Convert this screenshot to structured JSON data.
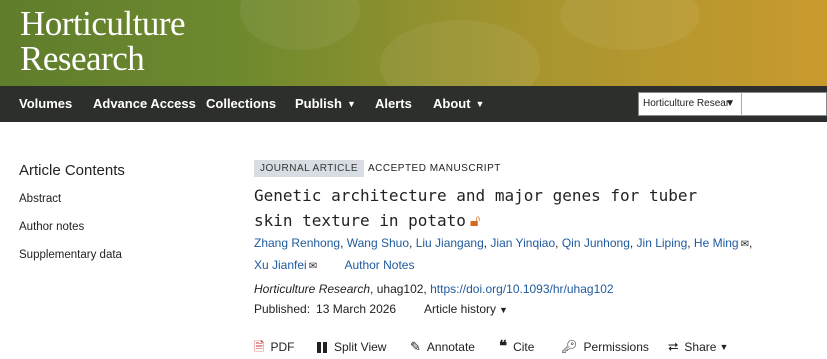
{
  "header": {
    "logo_line1": "Horticulture",
    "logo_line2": "Research"
  },
  "nav": {
    "items": [
      {
        "label": "Volumes",
        "has_dropdown": false
      },
      {
        "label": "Advance Access",
        "has_dropdown": false
      },
      {
        "label": "Collections",
        "has_dropdown": false
      },
      {
        "label": "Publish",
        "has_dropdown": true
      },
      {
        "label": "Alerts",
        "has_dropdown": false
      },
      {
        "label": "About",
        "has_dropdown": true
      }
    ],
    "search_scope": "Horticulture Resear",
    "search_value": ""
  },
  "sidebar": {
    "title": "Article Contents",
    "items": [
      "Abstract",
      "Author notes",
      "Supplementary data"
    ]
  },
  "article": {
    "type_badge": "JOURNAL ARTICLE",
    "status_badge": "ACCEPTED MANUSCRIPT",
    "title_line1": "Genetic architecture and major genes for tuber",
    "title_line2": "skin texture in potato",
    "authors": [
      "Zhang Renhong",
      "Wang Shuo",
      "Liu Jiangang",
      "Jian Yinqiao",
      "Qin Junhong",
      "Jin Liping",
      "He Ming",
      "Xu Jianfei"
    ],
    "author_notes_label": "Author Notes",
    "journal": "Horticulture Research",
    "article_id": ", uhag102, ",
    "doi": "https://doi.org/10.1093/hr/uhag102",
    "published_label": "Published:",
    "published_date": "13 March 2026",
    "history_label": "Article history"
  },
  "toolbar": {
    "pdf": "PDF",
    "split_view": "Split View",
    "annotate": "Annotate",
    "cite": "Cite",
    "permissions": "Permissions",
    "share": "Share"
  },
  "colors": {
    "nav_bg": "#2d2f2c",
    "link": "#1f5a9e",
    "banner_start": "#5f7d2c",
    "banner_end": "#c99a2e",
    "open_access": "#d36a1f"
  }
}
